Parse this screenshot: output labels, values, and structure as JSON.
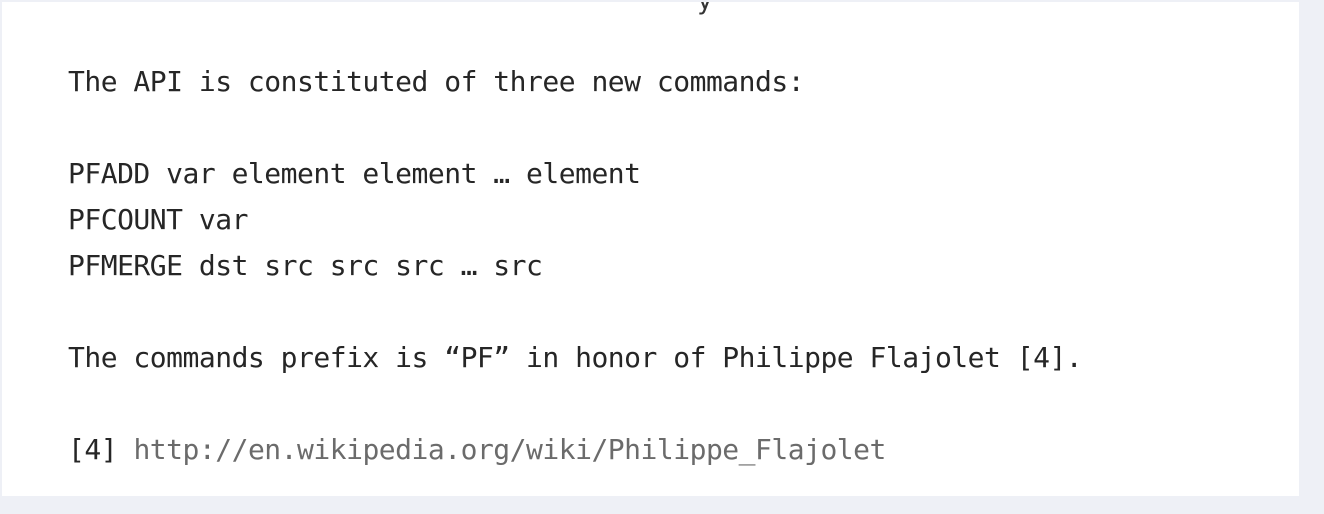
{
  "document": {
    "cut_off_glyph": "y",
    "intro": "The API is constituted of three new commands:",
    "commands": [
      "PFADD var element element … element",
      "PFCOUNT var",
      "PFMERGE dst src src src … src"
    ],
    "prefix_note": "The commands prefix is “PF” in honor of Philippe Flajolet [4].",
    "footnote": {
      "marker": "[4]",
      "url": "http://en.wikipedia.org/wiki/Philippe_Flajolet"
    }
  }
}
